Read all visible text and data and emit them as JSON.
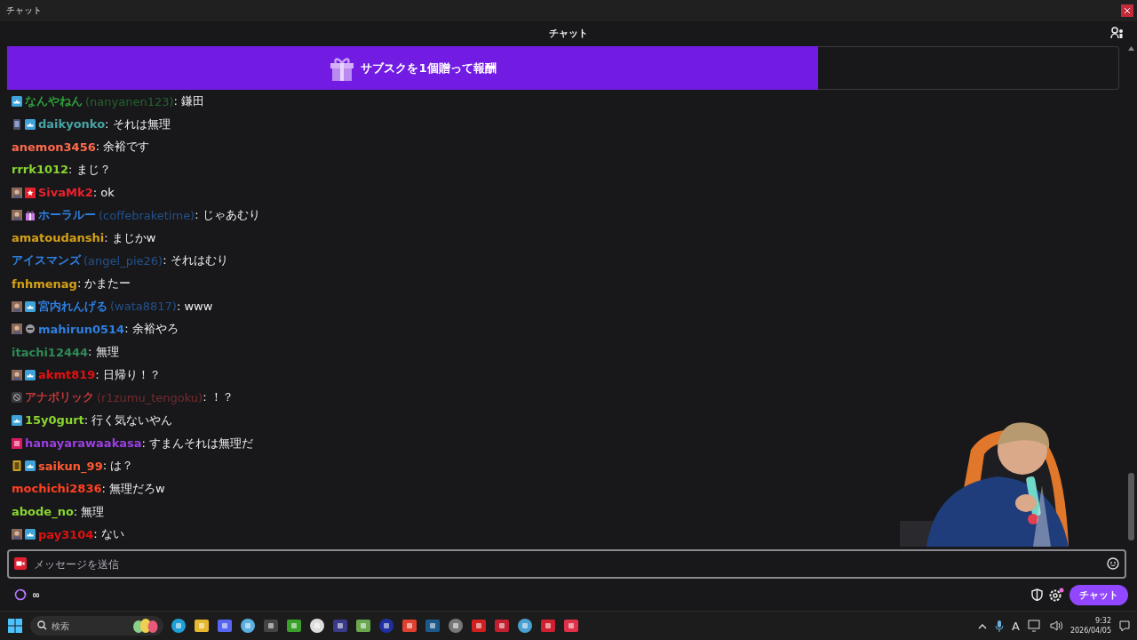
{
  "window": {
    "title": "チャット"
  },
  "header": {
    "title": "チャット"
  },
  "banner": {
    "label": "サブスクを1個贈って報酬"
  },
  "messages": [
    {
      "badges": [
        {
          "kind": "subscriber"
        }
      ],
      "name": "なんやねん",
      "login": "(nanyanen123)",
      "color": "#2e9e3a",
      "text": ": 鎌田"
    },
    {
      "badges": [
        {
          "kind": "card"
        },
        {
          "kind": "subscriber"
        }
      ],
      "name": "daikyonko",
      "color": "#4aa3a3",
      "text": ": それは無理"
    },
    {
      "name": "anemon3456",
      "color": "#ff6a4a",
      "text": ": 余裕です"
    },
    {
      "name": "rrrk1012",
      "color": "#8ad62e",
      "text": ": まじ？"
    },
    {
      "badges": [
        {
          "kind": "avatar"
        },
        {
          "kind": "star"
        }
      ],
      "name": "SivaMk2",
      "color": "#e8222c",
      "text": ": ok"
    },
    {
      "badges": [
        {
          "kind": "avatar"
        },
        {
          "kind": "gift"
        }
      ],
      "name": "ホーラルー",
      "login": "(coffebraketime)",
      "color": "#2e7fe0",
      "text": ": じゃあむり"
    },
    {
      "name": "amatoudanshi",
      "color": "#d4a017",
      "text": ": まじかw"
    },
    {
      "name": "アイスマンズ",
      "login": "(angel_pie26)",
      "color": "#2e7fe0",
      "text": ": それはむり"
    },
    {
      "name": "fnhmenag",
      "color": "#d4a017",
      "text": ": かまたー"
    },
    {
      "badges": [
        {
          "kind": "avatar"
        },
        {
          "kind": "subscriber"
        }
      ],
      "name": "宮内れんげる",
      "login": "(wata8817)",
      "color": "#2e7fe0",
      "text": ": www"
    },
    {
      "badges": [
        {
          "kind": "avatar"
        },
        {
          "kind": "mask"
        }
      ],
      "name": "mahirun0514",
      "color": "#2e7fe0",
      "text": ": 余裕やろ"
    },
    {
      "name": "itachi12444",
      "color": "#2e8b57",
      "text": ": 無理"
    },
    {
      "badges": [
        {
          "kind": "avatar"
        },
        {
          "kind": "subscriber"
        }
      ],
      "name": "akmt819",
      "color": "#e01010",
      "text": ": 日帰り！？"
    },
    {
      "badges": [
        {
          "kind": "slash"
        }
      ],
      "name": "アナボリック",
      "login": "(r1zumu_tengoku)",
      "color": "#c0393b",
      "text": ": ！？"
    },
    {
      "badges": [
        {
          "kind": "subscriber"
        }
      ],
      "name": "15y0gurt",
      "color": "#8ad62e",
      "text": ": 行く気ないやん"
    },
    {
      "badges": [
        {
          "kind": "pink"
        }
      ],
      "name": "hanayarawaakasa",
      "color": "#9b3fe0",
      "text": ": すまんそれは無理だ"
    },
    {
      "badges": [
        {
          "kind": "gold"
        },
        {
          "kind": "subscriber"
        }
      ],
      "name": "saikun_99",
      "color": "#ff5a30",
      "text": ": は？"
    },
    {
      "name": "mochichi2836",
      "color": "#ff4020",
      "text": ": 無理だろw"
    },
    {
      "name": "abode_no",
      "color": "#8ad62e",
      "text": ": 無理"
    },
    {
      "badges": [
        {
          "kind": "avatar"
        },
        {
          "kind": "subscriber"
        }
      ],
      "name": "pay3104",
      "color": "#e01010",
      "text": ": ない"
    }
  ],
  "input": {
    "placeholder": "メッセージを送信"
  },
  "points": {
    "value": "∞"
  },
  "chat_button": {
    "label": "チャット"
  },
  "taskbar": {
    "search_placeholder": "検索",
    "ime": "A",
    "time": "9:32",
    "date": "2026/04/05"
  }
}
